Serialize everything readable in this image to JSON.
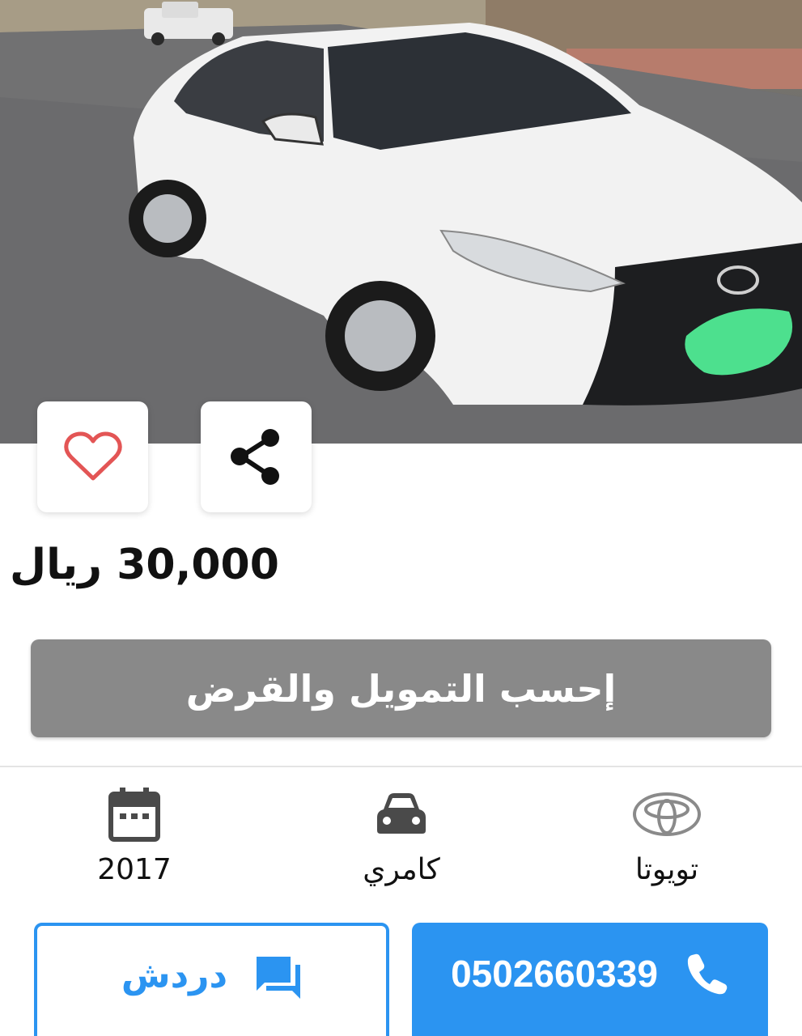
{
  "listing": {
    "price": "30,000 ريال"
  },
  "actions": {
    "favorite_icon": "heart-icon",
    "share_icon": "share-icon"
  },
  "finance": {
    "label": "إحسب التمويل والقرض"
  },
  "specs": {
    "make": {
      "label": "تويوتا",
      "icon": "toyota-logo-icon"
    },
    "model": {
      "label": "كامري",
      "icon": "car-icon"
    },
    "year": {
      "label": "2017",
      "icon": "calendar-icon"
    }
  },
  "contact": {
    "chat_label": "دردش",
    "chat_icon": "chat-icon",
    "phone": "0502660339",
    "phone_icon": "phone-icon"
  },
  "colors": {
    "accent_blue": "#2b94f1",
    "finance_gray": "#898989",
    "heart_red": "#e35555"
  }
}
